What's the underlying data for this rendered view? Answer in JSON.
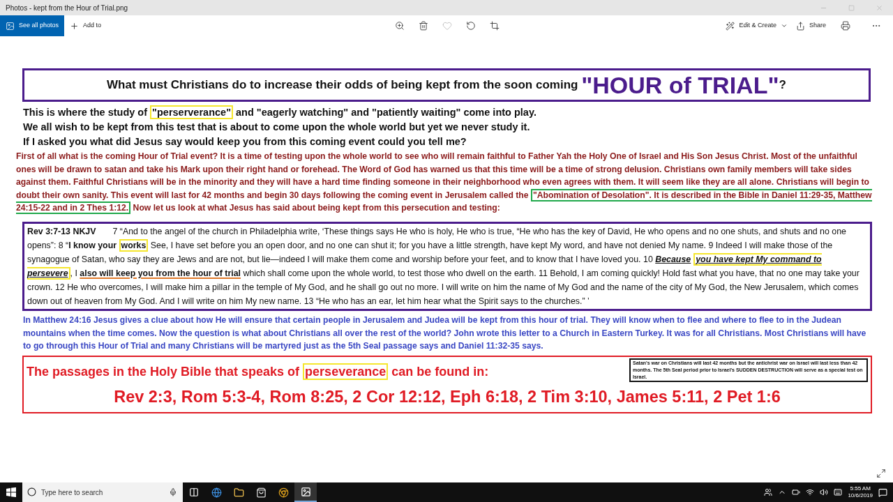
{
  "window": {
    "title": "Photos - kept from the Hour of Trial.png"
  },
  "toolbar": {
    "left": [
      {
        "kind": "photos",
        "label": "See all photos",
        "selected": true
      },
      {
        "kind": "add",
        "label": "Add to",
        "selected": false
      }
    ],
    "right": [
      {
        "kind": "edit",
        "label": "Edit & Create"
      },
      {
        "kind": "share",
        "label": "Share"
      }
    ]
  },
  "slide": {
    "title": [
      {
        "kind": "plain",
        "text": "What must Christians do to increase their odds of being kept from the soon coming "
      },
      {
        "kind": "large",
        "text": "\"HOUR of TRIAL\""
      },
      {
        "kind": "plain",
        "text": "?"
      }
    ],
    "intro_lines": [
      [
        {
          "kind": "plain",
          "text": "This is where the study of "
        },
        {
          "kind": "boxed",
          "text": "\"perserverance\""
        },
        {
          "kind": "plain",
          "text": " and \"eagerly watching\" and \"patiently waiting\" come into play."
        }
      ],
      [
        {
          "kind": "plain",
          "text": "We all wish to be kept from this test that is about to come upon the whole world but yet we never study it."
        }
      ],
      [
        {
          "kind": "plain",
          "text": "If I asked you what did Jesus say would keep you from this coming event could you tell me?"
        }
      ]
    ],
    "explanation": [
      {
        "kind": "plain",
        "text": "First of all what is the coming Hour of Trial event? It is a time of testing upon the whole world to see who will remain faithful to Father Yah the Holy One of Israel and His Son Jesus Christ. Most of the unfaithful ones will be drawn to satan and take his Mark upon their right hand or forehead. The Word of God has warned us that this time will be a time of strong delusion. Christians own family members will take sides against them. Faithful Christians will be in the minority and they will have a hard time finding someone in their neighborhood who even agrees with them. It will seem like they are all alone. Christians will begin to doubt their own sanity. This event will last for 42 months and begin 30 days following the coming event in Jerusalem called the "
      },
      {
        "kind": "framed",
        "text": "\"Abomination of Desolation\". It is described in the Bible in Daniel 11:29-35, Matthew 24:15-22 and in 2 Thes 1:12."
      },
      {
        "kind": "plain",
        "text": " Now let us look at what Jesus has said about being kept from this persecution and testing:"
      }
    ],
    "verse": [
      {
        "kind": "bold",
        "text": "Rev 3:7-13 NKJV"
      },
      {
        "kind": "indent",
        "text": "7 “And to the angel of the church in Philadelphia write, ‘These things says He who is holy, He who is true, “He who has the key of David, He who opens and no one shuts, and shuts and no one opens”: 8 “"
      },
      {
        "kind": "bold",
        "text": "I know your "
      },
      {
        "kind": "boxed",
        "text": "works"
      },
      {
        "kind": "plain",
        "text": " See, I have set before you an open door, and no one can shut it; for you have a little strength, have kept My word, and have not denied My name. 9 Indeed I will make those of the synagogue of Satan, who say they are Jews and are not, but lie—indeed I will make them come and worship before your feet, and to know that I have loved you. 10 "
      },
      {
        "kind": "stressed",
        "text": "Because"
      },
      {
        "kind": "stressed_boxed",
        "text": "you have kept My command to persevere"
      },
      {
        "kind": "plain",
        "text": ", I "
      },
      {
        "kind": "marked",
        "text": "also will keep you from the hour of trial"
      },
      {
        "kind": "plain",
        "text": " which shall come upon the whole world, to test those who dwell on the earth. 11 Behold, I am coming quickly! Hold fast what you have, that no one may take your crown. 12 He who overcomes, I will make him a pillar in the temple of My God, and he shall go out no more. I will write on him the name of My God and the name of the city of My God, the New Jerusalem, which comes down out of heaven from My God. And I will write on him My new name. 13 “He who has an ear, let him hear what the Spirit says to the churches.” ’"
      }
    ],
    "commentary": "In Matthew 24:16 Jesus gives a clue about how He will ensure that certain people in Jerusalem and Judea will be kept from this hour of trial. They will know when to flee and where to flee to in the Judean mountains when the time comes. Now the question is what about Christians all over the rest of the world? John wrote this letter to a Church in Eastern Turkey. It was for all Christians. Most Christians will have to go through this Hour of Trial and many Christians will be martyred just as the 5th Seal passage says and Daniel 11:32-35 says.",
    "passages_heading": [
      {
        "kind": "plain",
        "text": "The passages in the Holy Bible that speaks of "
      },
      {
        "kind": "boxed",
        "text": "perseverance"
      },
      {
        "kind": "plain",
        "text": " can be found in:"
      }
    ],
    "passages": "Rev 2:3, Rom 5:3-4, Rom 8:25, 2 Cor 12:12, Eph 6:18, 2 Tim 3:10, James 5:11, 2 Pet 1:6",
    "side_note": "Satan's war on Christians will last 42 months but the antichrist war on Israel will last less than 42 months. The 5th Seal period prior to Israel's SUDDEN DESTRUCTION will serve as a special test on Israel."
  },
  "taskbar": {
    "search": {
      "placeholder": "Type here to search"
    },
    "time": "5:55 AM",
    "date": "10/6/2019"
  }
}
